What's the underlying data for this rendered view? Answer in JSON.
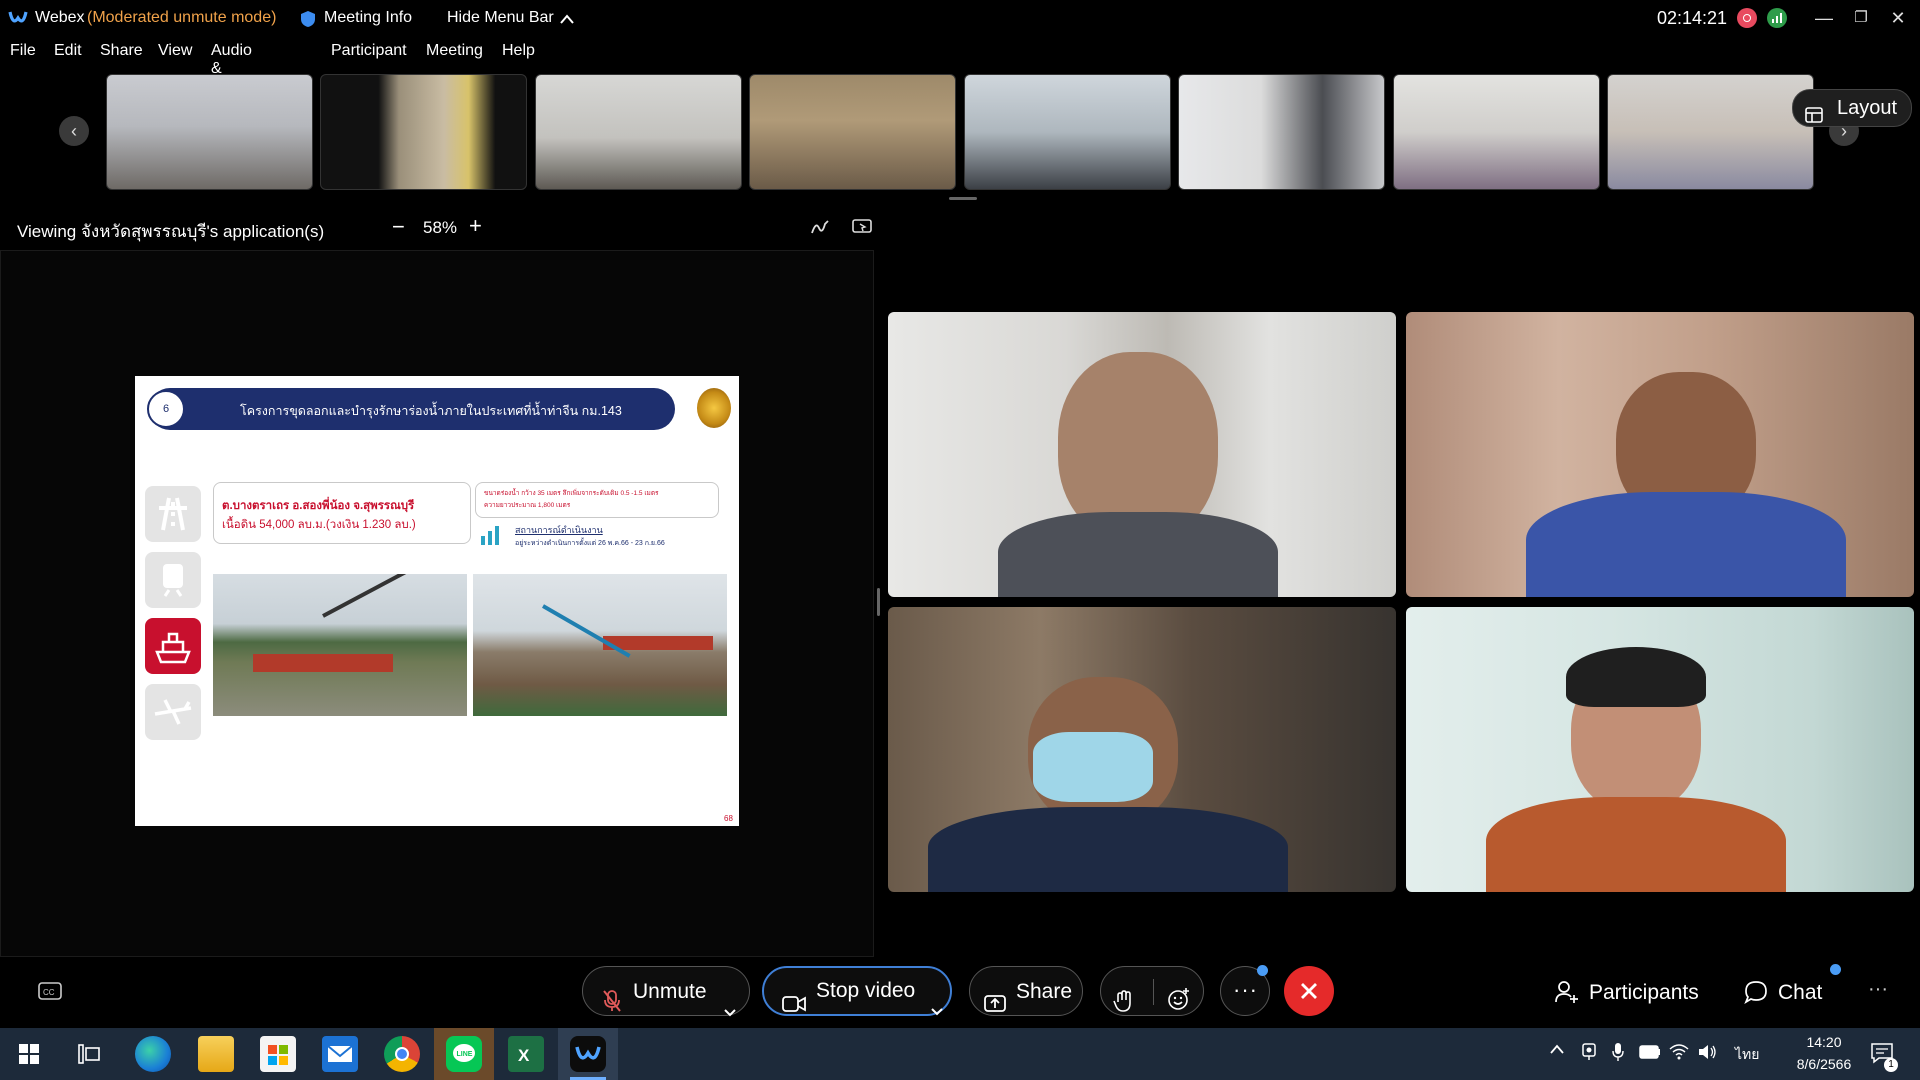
{
  "window": {
    "app_name": "Webex",
    "mode": "(Moderated unmute mode)",
    "meeting_info": "Meeting Info",
    "hide_menu": "Hide Menu Bar",
    "timer": "02:14:21"
  },
  "menu": [
    "File",
    "Edit",
    "Share",
    "View",
    "Audio & Video",
    "Participant",
    "Meeting",
    "Help"
  ],
  "layout_button": "Layout",
  "share": {
    "viewing_label": "Viewing จังหวัดสุพรรณบุรี's application(s)",
    "zoom": "58%"
  },
  "slide": {
    "number": "6",
    "title": "โครงการขุดลอกและบำรุงรักษาร่องน้ำภายในประเทศที่น้ำท่าจีน กม.143",
    "location_line1": "ต.บางตราเถร อ.สองพี่น้อง จ.สุพรรณบุรี",
    "location_line2": "เนื้อดิน 54,000 ลบ.ม.(วงเงิน 1.230 ลบ.)",
    "spec_line1": "ขนาดร่องน้ำ กว้าง 35 เมตร ลึกเพิ่มจากระดับเดิม 0.5 -1.5 เมตร",
    "spec_line2": "ความยาวประมาณ 1,800 เมตร",
    "status_label": "สถานการณ์ดำเนินงาน",
    "status_detail": "อยู่ระหว่างดำเนินการตั้งแต่ 26 พ.ค.66 - 23 ก.ย.66",
    "page": "68"
  },
  "controls": {
    "unmute": "Unmute",
    "stop_video": "Stop video",
    "share": "Share",
    "participants": "Participants",
    "chat": "Chat",
    "end_color": "#e52a2a"
  },
  "taskbar": {
    "time": "14:20",
    "date": "8/6/2566",
    "lang": "ไทย",
    "notif_count": "1"
  }
}
